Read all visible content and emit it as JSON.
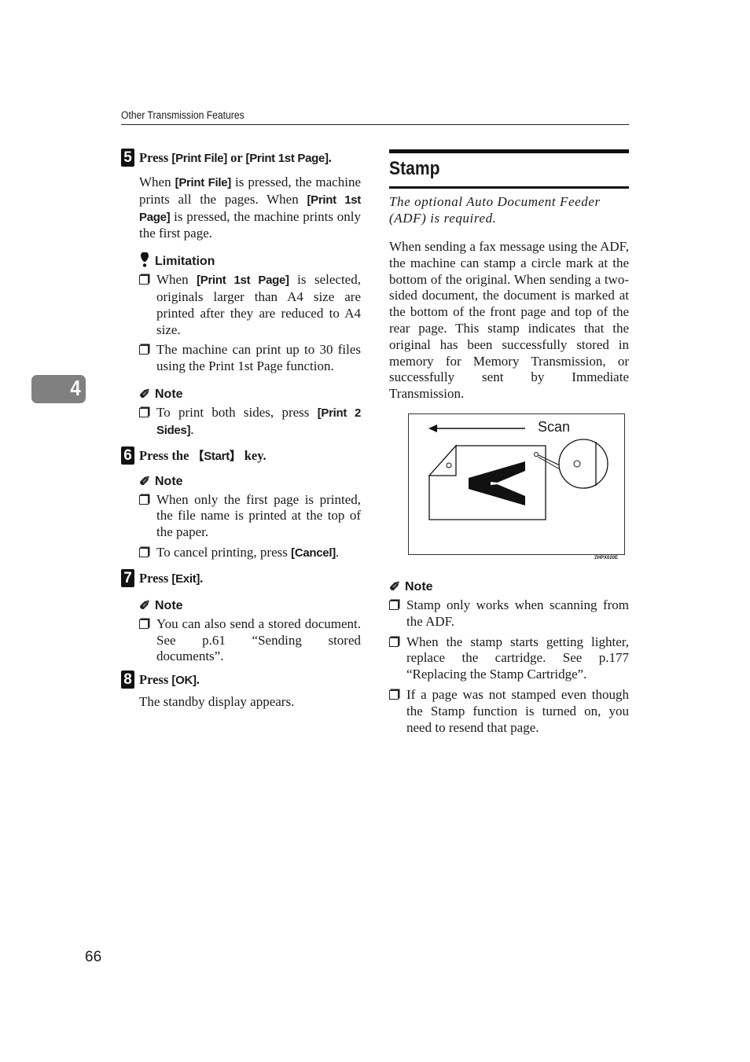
{
  "header": {
    "running_title": "Other Transmission Features"
  },
  "chapter_tab": {
    "number": "4"
  },
  "page_number": "66",
  "left_column": {
    "step5": {
      "number": "5",
      "title_prefix": "Press ",
      "title_key1": "[Print File]",
      "title_mid": " or ",
      "title_key2": "[Print 1st Page]",
      "title_suffix": ".",
      "body": {
        "p1": "When ",
        "k1": "[Print File]",
        "p2": " is pressed, the machine prints all the pages. When ",
        "k2": "[Print 1st Page]",
        "p3": " is pressed, the machine prints only the first page."
      },
      "limitation": {
        "icon": "exclamation-icon",
        "heading": "Limitation",
        "items": [
          {
            "pre": "When ",
            "key": "[Print 1st Page]",
            "post": " is selected, originals larger than A4 size are printed after they are reduced to A4 size."
          },
          {
            "pre": "The machine can print up to 30 files using the Print 1st Page function.",
            "key": "",
            "post": ""
          }
        ]
      },
      "note": {
        "icon": "pencil-icon",
        "heading": "Note",
        "items": [
          {
            "pre": "To print both sides, press ",
            "key": "[Print 2 Sides]",
            "post": "."
          }
        ]
      }
    },
    "step6": {
      "number": "6",
      "title_prefix": "Press the ",
      "title_key": "【Start】",
      "title_suffix": " key.",
      "note": {
        "heading": "Note",
        "items": [
          {
            "pre": "When only the first page is printed, the file name is printed at the top of the paper.",
            "key": "",
            "post": ""
          },
          {
            "pre": "To cancel printing, press ",
            "key": "[Cancel]",
            "post": "."
          }
        ]
      }
    },
    "step7": {
      "number": "7",
      "title_prefix": "Press ",
      "title_key": "[Exit]",
      "title_suffix": ".",
      "note": {
        "heading": "Note",
        "items": [
          {
            "pre": "You can also send a stored document. See p.61 “Sending stored documents”.",
            "key": "",
            "post": ""
          }
        ]
      }
    },
    "step8": {
      "number": "8",
      "title_prefix": "Press ",
      "title_key": "[OK]",
      "title_suffix": ".",
      "body": "The standby display appears."
    }
  },
  "right_column": {
    "section_title": "Stamp",
    "requirement": "The optional Auto Document Feeder (ADF) is required.",
    "body": "When sending a fax message using the ADF, the machine can stamp a circle mark at the bottom of the original. When sending a two-sided document, the document is marked at the bottom of the front page and top of the rear page. This stamp indicates that the original has been successfully stored in memory for Memory Transmission, or successfully sent by Immediate Transmission.",
    "figure": {
      "scan_label": "Scan",
      "letter": "A",
      "code": "ZHPX020E"
    },
    "note": {
      "heading": "Note",
      "items": [
        "Stamp only works when scanning from the ADF.",
        "When the stamp starts getting lighter, replace the cartridge. See p.177 “Replacing the Stamp Cartridge”.",
        "If a page was not stamped even though the Stamp function is turned on, you need to resend that page."
      ]
    }
  }
}
